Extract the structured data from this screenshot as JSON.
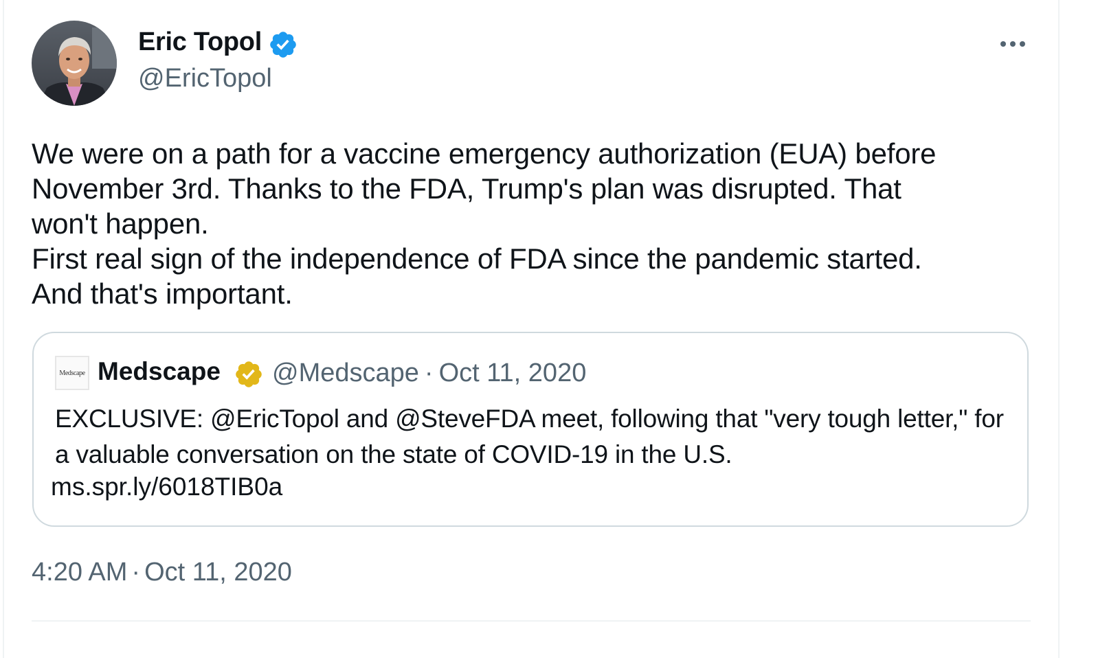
{
  "author": {
    "name": "Eric Topol",
    "handle": "@EricTopol",
    "verified_color": "#1d9bf0"
  },
  "tweet": {
    "text": "We were on a path for a vaccine emergency authorization (EUA) before\nNovember 3rd. Thanks to the FDA, Trump's plan was disrupted. That\nwon't happen.\nFirst real sign of the independence of FDA since the pandemic started.\nAnd that's important.",
    "time": "4:20 AM",
    "date": "Oct 11, 2020"
  },
  "quoted": {
    "avatar_text": "Medscape",
    "name": "Medscape",
    "handle": "@Medscape",
    "date": "Oct 11, 2020",
    "verified_color": "#e2b719",
    "text": "EXCLUSIVE: @EricTopol and @SteveFDA meet, following that \"very tough letter,\" for a valuable conversation on the state of COVID-19 in the U.S.",
    "link": "ms.spr.ly/6018TIB0a"
  },
  "icons": {
    "more": "more-horizontal-icon",
    "verified": "verified-badge-icon"
  },
  "separator": "·",
  "colors": {
    "text_primary": "#0f1419",
    "text_secondary": "#536471",
    "border": "#cfd9de"
  }
}
